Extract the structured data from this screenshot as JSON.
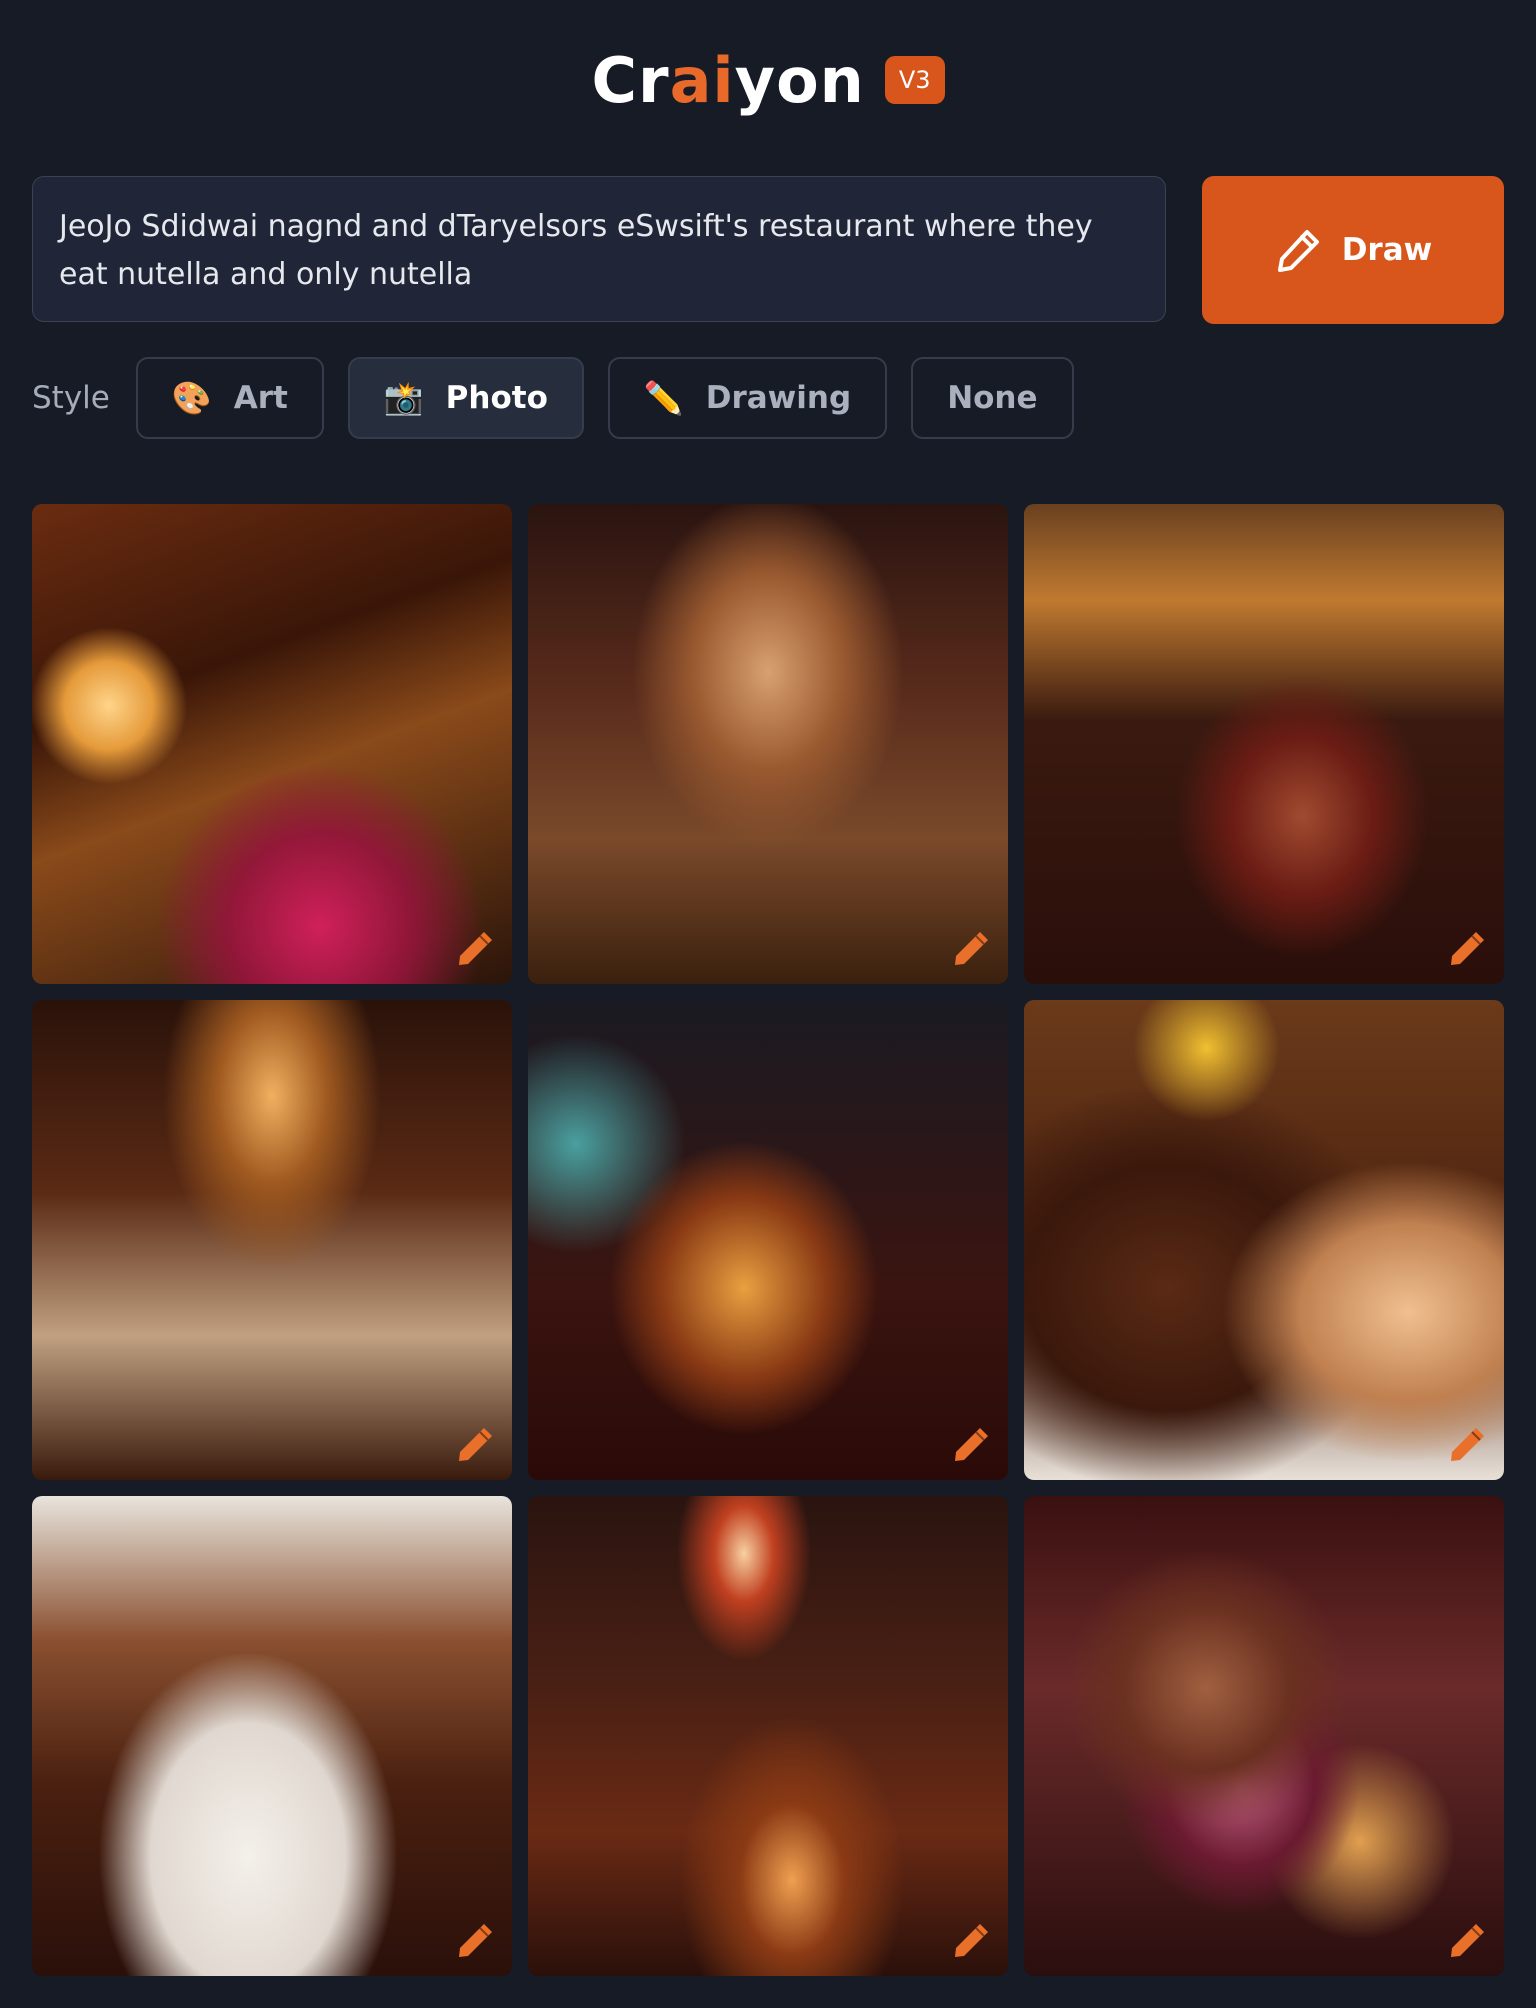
{
  "brand": {
    "name_part1": "Cr",
    "name_part2": "ai",
    "name_part3": "yon",
    "version": "V3",
    "accent_color": "#d8561c"
  },
  "prompt": {
    "text": "JeoJo Sdidwai nagnd and dTaryelsors eSwsift's restaurant where they eat nutella and only nutella"
  },
  "draw_button": {
    "label": "Draw",
    "icon": "pencil-icon"
  },
  "style": {
    "label": "Style",
    "options": [
      {
        "label": "Art",
        "emoji": "🎨",
        "active": false
      },
      {
        "label": "Photo",
        "emoji": "📸",
        "active": true
      },
      {
        "label": "Drawing",
        "emoji": "✏️",
        "active": false
      },
      {
        "label": "None",
        "emoji": "",
        "active": false
      }
    ]
  },
  "results": [
    {
      "name": "result-image-1",
      "edit_icon": "pencil-icon"
    },
    {
      "name": "result-image-2",
      "edit_icon": "pencil-icon"
    },
    {
      "name": "result-image-3",
      "edit_icon": "pencil-icon"
    },
    {
      "name": "result-image-4",
      "edit_icon": "pencil-icon"
    },
    {
      "name": "result-image-5",
      "edit_icon": "pencil-icon"
    },
    {
      "name": "result-image-6",
      "edit_icon": "pencil-icon"
    },
    {
      "name": "result-image-7",
      "edit_icon": "pencil-icon"
    },
    {
      "name": "result-image-8",
      "edit_icon": "pencil-icon"
    },
    {
      "name": "result-image-9",
      "edit_icon": "pencil-icon"
    }
  ]
}
